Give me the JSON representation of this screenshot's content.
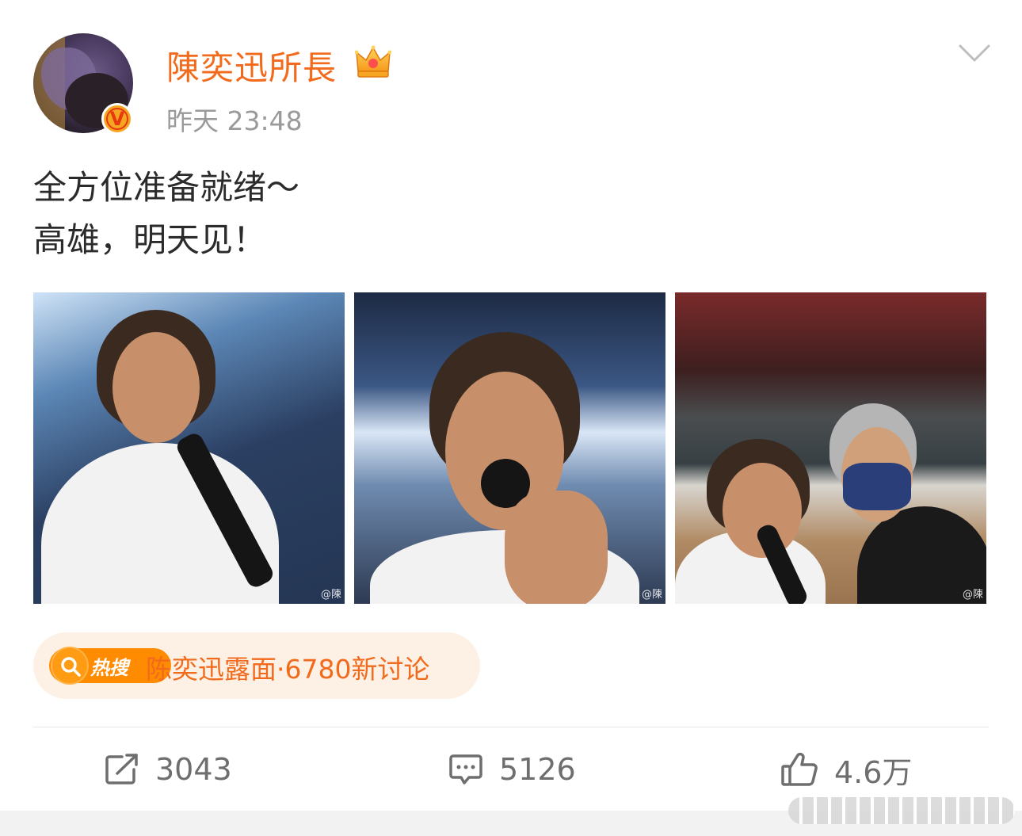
{
  "post": {
    "author": "陳奕迅所長",
    "timestamp": "昨天 23:48",
    "verified_badge": "V",
    "text_lines": [
      "全方位准备就绪～",
      "高雄，明天见！"
    ],
    "photos": [
      {
        "alt": "Selfie on stage holding microphone",
        "watermark": "@陳"
      },
      {
        "alt": "Singing into microphone under stage lights",
        "watermark": "@陳"
      },
      {
        "alt": "Selfie with masked companion in empty arena",
        "watermark": "@陳"
      }
    ]
  },
  "hot_search": {
    "badge_label": "热搜",
    "topic": "陈奕迅露面·6780新讨论"
  },
  "actions": {
    "repost_count": "3043",
    "comment_count": "5126",
    "like_count": "4.6万"
  },
  "icons": {
    "repost": "repost-icon",
    "comment": "comment-icon",
    "like": "thumbs-up-icon",
    "more": "chevron-down-icon",
    "crown": "crown-icon",
    "search": "search-icon"
  },
  "colors": {
    "brand_orange": "#f26a1b",
    "hot_badge": "#ff8b00",
    "hot_bg": "#fdf1e5",
    "muted": "#9a9a9a"
  }
}
